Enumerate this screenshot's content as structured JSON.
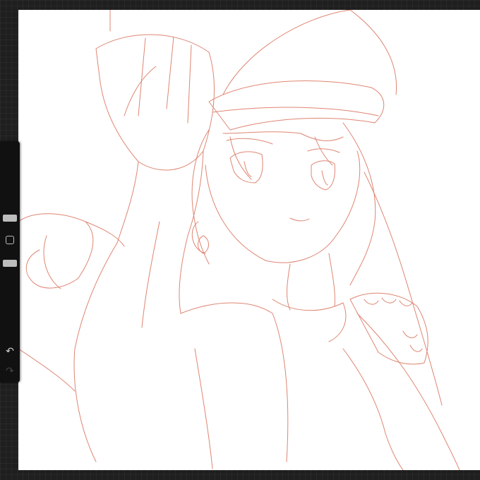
{
  "app": {
    "name": "",
    "background_color": "#1f1f1f"
  },
  "canvas": {
    "background_color": "#ffffff",
    "sketch_color": "#d9705a",
    "subject": ""
  },
  "sidebar": {
    "brush_size": 0.31,
    "brush_opacity": 0.5,
    "icons": {
      "size_slider": "slider-handle",
      "modify": "square-outline-icon",
      "opacity_slider": "slider-handle",
      "undo": "undo-arrow-icon",
      "redo": "redo-arrow-icon"
    },
    "undo_glyph": "↶",
    "redo_glyph": "↷"
  }
}
